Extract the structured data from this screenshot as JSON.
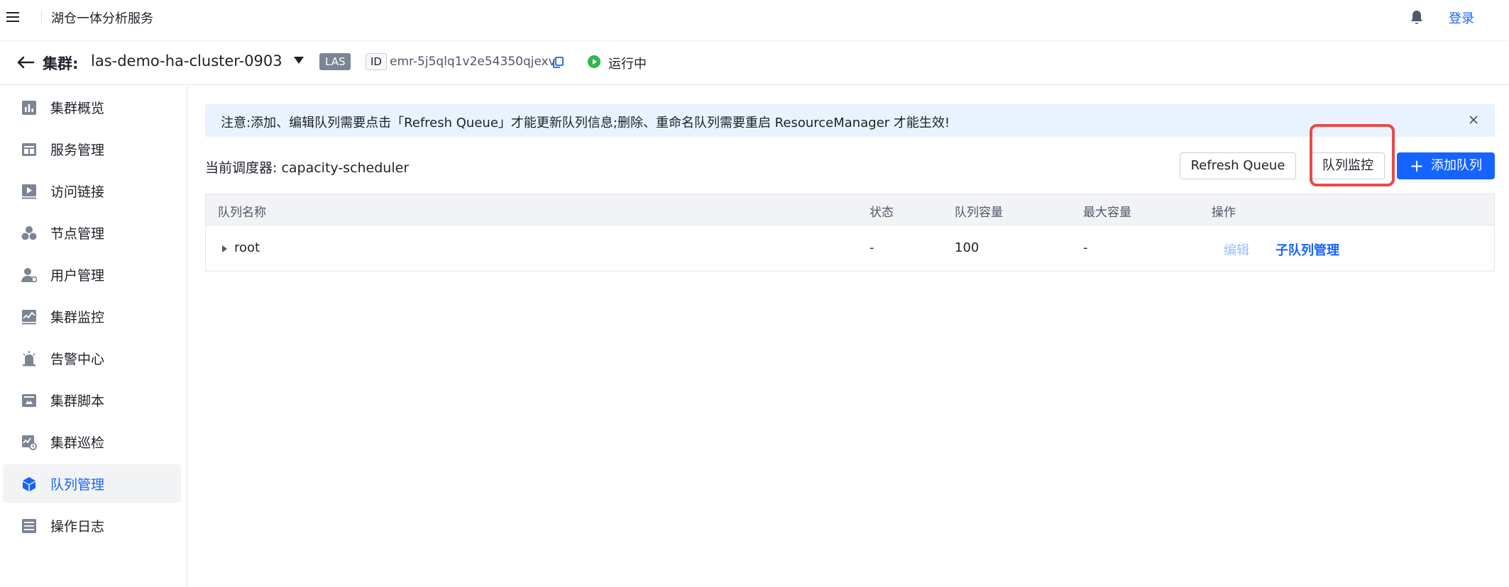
{
  "header": {
    "app_title": "湖仓一体分析服务",
    "login_label": "登录"
  },
  "cluster": {
    "label": "集群:",
    "name": "las-demo-ha-cluster-0903",
    "tag": "LAS",
    "id_tag": "ID",
    "id_value": "emr-5j5qlq1v2e54350qjexv",
    "status": "运行中"
  },
  "sidebar": {
    "items": [
      {
        "label": "集群概览",
        "icon": "bar-chart-icon"
      },
      {
        "label": "服务管理",
        "icon": "table-icon"
      },
      {
        "label": "访问链接",
        "icon": "play-link-icon"
      },
      {
        "label": "节点管理",
        "icon": "nodes-icon"
      },
      {
        "label": "用户管理",
        "icon": "user-icon"
      },
      {
        "label": "集群监控",
        "icon": "monitor-icon"
      },
      {
        "label": "告警中心",
        "icon": "alarm-icon"
      },
      {
        "label": "集群脚本",
        "icon": "script-icon"
      },
      {
        "label": "集群巡检",
        "icon": "inspection-icon"
      },
      {
        "label": "队列管理",
        "icon": "cube-icon",
        "active": true
      },
      {
        "label": "操作日志",
        "icon": "log-icon"
      }
    ]
  },
  "notice": {
    "text": "注意:添加、编辑队列需要点击「Refresh Queue」才能更新队列信息;删除、重命名队列需要重启 ResourceManager 才能生效!"
  },
  "toolbar": {
    "scheduler": "当前调度器: capacity-scheduler",
    "refresh_label": "Refresh Queue",
    "monitor_label": "队列监控",
    "add_label": "添加队列"
  },
  "table": {
    "columns": [
      "队列名称",
      "状态",
      "队列容量",
      "最大容量",
      "操作"
    ],
    "rows": [
      {
        "name": "root",
        "status": "-",
        "capacity": "100",
        "max_capacity": "-",
        "edit": "编辑",
        "sub_manage": "子队列管理"
      }
    ]
  },
  "colors": {
    "primary": "#1664ff",
    "notice_bg": "#e8f3ff",
    "highlight": "#e84a4a",
    "running": "#2eb84f"
  }
}
